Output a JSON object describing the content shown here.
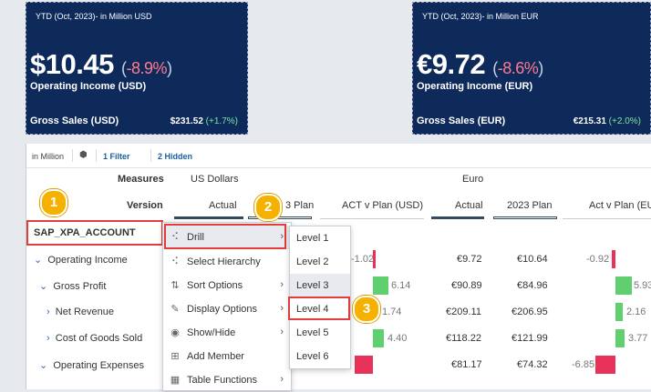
{
  "kpi_usd": {
    "subtitle": "YTD (Oct, 2023)- in Million USD",
    "value": "$10.45",
    "variance": "-8.9%",
    "label": "Operating Income (USD)",
    "gs_label": "Gross Sales (USD)",
    "gs_value": "$231.52",
    "gs_var": "+1.7%"
  },
  "kpi_eur": {
    "subtitle": "YTD (Oct, 2023)- in Million EUR",
    "value": "€9.72",
    "variance": "-8.6%",
    "label": "Operating Income (EUR)",
    "gs_label": "Gross Sales (EUR)",
    "gs_value": "€215.31",
    "gs_var": "+2.0%"
  },
  "toolbar": {
    "unit": "in Million",
    "filter": "1 Filter",
    "hidden": "2 Hidden"
  },
  "header": {
    "measures_label": "Measures",
    "version_label": "Version",
    "currency_usd": "US Dollars",
    "currency_eur": "Euro",
    "cols": [
      "Actual",
      "3 Plan",
      "ACT v Plan (USD)",
      "Actual",
      "2023 Plan",
      "Act v Plan (EU"
    ]
  },
  "dimension_label": "SAP_XPA_ACCOUNT",
  "rows": [
    {
      "label": "Operating Income",
      "v1": "-1.02",
      "eur_actual": "€9.72",
      "eur_plan": "€10.64",
      "eur_var": "-0.92"
    },
    {
      "label": "Gross Profit",
      "v1": "6.14",
      "eur_actual": "€90.89",
      "eur_plan": "€84.96",
      "eur_var": "5.93"
    },
    {
      "label": "Net Revenue",
      "v1": "1.74",
      "eur_actual": "€209.11",
      "eur_plan": "€206.95",
      "eur_var": "2.16"
    },
    {
      "label": "Cost of Goods Sold",
      "v1": "4.40",
      "eur_actual": "€118.22",
      "eur_plan": "€121.99",
      "eur_var": "3.77"
    },
    {
      "label": "Operating Expenses",
      "v1": "",
      "eur_actual": "€81.17",
      "eur_plan": "€74.32",
      "eur_var": "-6.85"
    }
  ],
  "context_menu": {
    "items": [
      "Drill",
      "Select Hierarchy",
      "Sort Options",
      "Display Options",
      "Show/Hide",
      "Add Member",
      "Table Functions"
    ]
  },
  "submenu": {
    "items": [
      "Level 1",
      "Level 2",
      "Level 3",
      "Level 4",
      "Level 5",
      "Level 6"
    ]
  },
  "badges": [
    "1",
    "2",
    "3"
  ],
  "colors": {
    "kpi_bg": "#0e2a5b",
    "negative": "#e8325a",
    "positive": "#5fcf6f",
    "highlight": "#e23c3c",
    "badge": "#f6b100"
  }
}
